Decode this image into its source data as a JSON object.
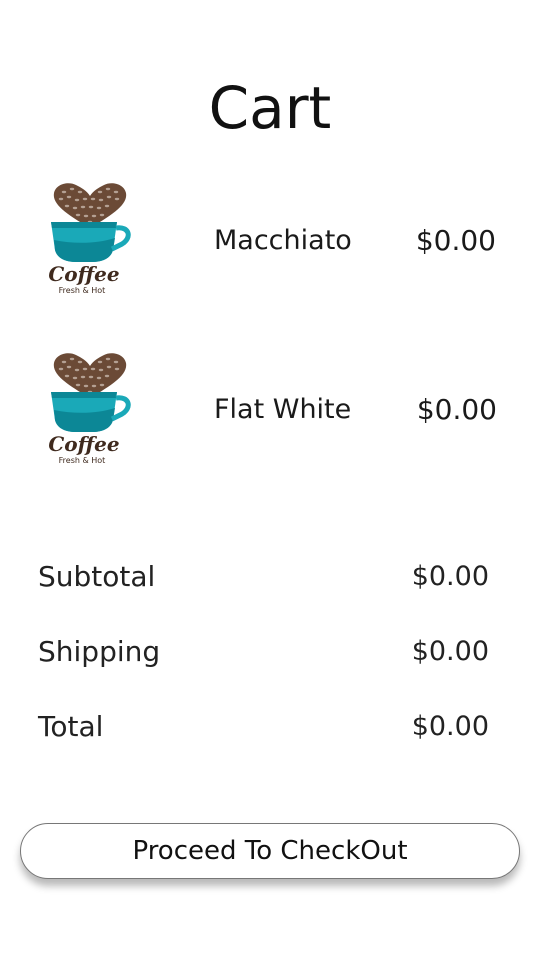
{
  "page": {
    "title": "Cart"
  },
  "cart": {
    "items": [
      {
        "name": "Macchiato",
        "price": "$0.00",
        "logo": {
          "word": "Coffee",
          "tagline": "Fresh & Hot"
        }
      },
      {
        "name": "Flat White",
        "price": "$0.00",
        "logo": {
          "word": "Coffee",
          "tagline": "Fresh & Hot"
        }
      }
    ]
  },
  "summary": {
    "subtotal": {
      "label": "Subtotal",
      "value": "$0.00"
    },
    "shipping": {
      "label": "Shipping",
      "value": "$0.00"
    },
    "total": {
      "label": "Total",
      "value": "$0.00"
    }
  },
  "checkout": {
    "label": "Proceed To CheckOut"
  },
  "colors": {
    "cup": "#1aa9b8",
    "cupShade": "#0c8796",
    "bean": "#6b4a36",
    "beanDark": "#3f2a1e",
    "text": "#1a1a1a"
  }
}
